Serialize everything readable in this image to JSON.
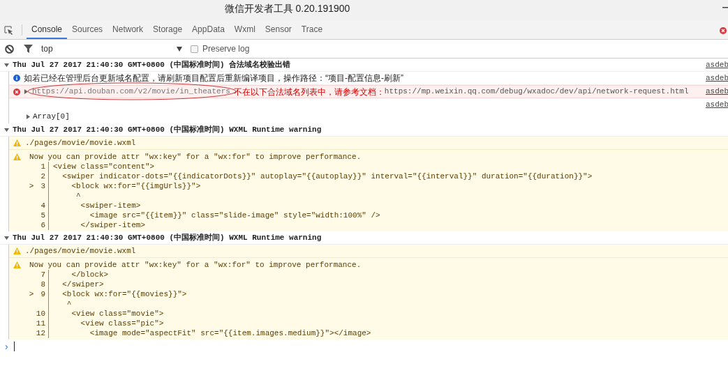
{
  "window": {
    "title": "微信开发者工具 0.20.191900"
  },
  "tabs": [
    {
      "label": "Console",
      "selected": true
    },
    {
      "label": "Sources",
      "selected": false
    },
    {
      "label": "Network",
      "selected": false
    },
    {
      "label": "Storage",
      "selected": false
    },
    {
      "label": "AppData",
      "selected": false
    },
    {
      "label": "Wxml",
      "selected": false
    },
    {
      "label": "Sensor",
      "selected": false
    },
    {
      "label": "Trace",
      "selected": false
    }
  ],
  "filter": {
    "context": "top",
    "preserve_log": {
      "label": "Preserve log",
      "checked": false
    }
  },
  "groups": [
    {
      "header": "Thu Jul 27 2017 21:40:30 GMT+0800 (中国标准时间) 合法域名校验出错",
      "expanded": true,
      "source": "asdeb",
      "kind": "plain",
      "messages": [
        {
          "kind": "info",
          "text": "如若已经在管理后台更新域名配置，请刷新项目配置后重新编译项目，操作路径：“项目-配置信息-刷新”",
          "source": "asdeb"
        },
        {
          "kind": "error",
          "expanded": false,
          "url": "https://api.douban.com/v2/movie/in_theaters",
          "text": "不在以下合法域名列表中，请参考文档：",
          "link": "https://mp.weixin.qq.com/debug/wxadoc/dev/api/network-request.html",
          "source": "asdeb",
          "circled": true
        },
        {
          "kind": "blank",
          "source": "asdeb"
        },
        {
          "kind": "object",
          "expanded": false,
          "text": "Array[0]"
        }
      ]
    },
    {
      "header": "Thu Jul 27 2017 21:40:30 GMT+0800 (中国标准时间) WXML Runtime warning",
      "expanded": true,
      "kind": "warning",
      "messages": [
        {
          "kind": "file",
          "text": "./pages/movie/movie.wxml"
        },
        {
          "kind": "code",
          "text": "Now you can provide attr \"wx:key\" for a \"wx:for\" to improve performance.",
          "lines": [
            {
              "number": "1",
              "code": "<view class=\"content\">"
            },
            {
              "number": "2",
              "code": "  <swiper indicator-dots=\"{{indicatorDots}}\" autoplay=\"{{autoplay}}\" interval=\"{{interval}}\" duration=\"{{duration}}\">"
            },
            {
              "marker": ">",
              "number": "3",
              "code": "    <block wx:for=\"{{imgUrls}}\">"
            },
            {
              "code": "     ^"
            },
            {
              "number": "4",
              "code": "      <swiper-item>"
            },
            {
              "number": "5",
              "code": "        <image src=\"{{item}}\" class=\"slide-image\" style=\"width:100%\" />"
            },
            {
              "number": "6",
              "code": "      </swiper-item>"
            }
          ]
        }
      ]
    },
    {
      "header": "Thu Jul 27 2017 21:40:30 GMT+0800 (中国标准时间) WXML Runtime warning",
      "expanded": true,
      "kind": "warning",
      "messages": [
        {
          "kind": "file",
          "text": "./pages/movie/movie.wxml"
        },
        {
          "kind": "code",
          "text": "Now you can provide attr \"wx:key\" for a \"wx:for\" to improve performance.",
          "lines": [
            {
              "number": "7",
              "code": "    </block>"
            },
            {
              "number": "8",
              "code": "  </swiper>"
            },
            {
              "marker": ">",
              "number": "9",
              "code": "  <block wx:for=\"{{movies}}\">"
            },
            {
              "code": "   ^"
            },
            {
              "number": "10",
              "code": "    <view class=\"movie\">"
            },
            {
              "number": "11",
              "code": "      <view class=\"pic\">"
            },
            {
              "number": "12",
              "code": "        <image mode=\"aspectFit\" src=\"{{item.images.medium}}\"></image>"
            }
          ]
        }
      ]
    }
  ],
  "prompt": {
    "symbol": "›"
  }
}
